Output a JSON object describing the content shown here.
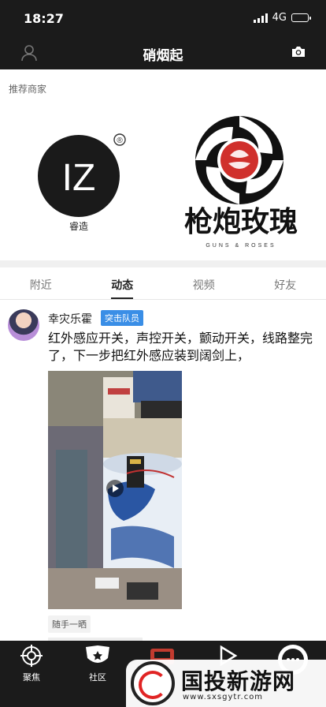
{
  "status_bar": {
    "time": "18:27",
    "network": "4G"
  },
  "navbar": {
    "title": "硝烟起"
  },
  "recommended": {
    "label": "推荐商家",
    "brands": [
      {
        "name_text": "睿造",
        "mark": "IZ",
        "registered": "®"
      },
      {
        "name_text": "枪炮玫瑰",
        "sub_text": "GUNS & ROSES"
      }
    ]
  },
  "tabs": [
    {
      "label": "附近",
      "active": false
    },
    {
      "label": "动态",
      "active": true
    },
    {
      "label": "视频",
      "active": false
    },
    {
      "label": "好友",
      "active": false
    }
  ],
  "post": {
    "username": "幸灾乐霍",
    "badge": "突击队员",
    "text": "红外感应开关，声控开关，颤动开关，线路整完了，下一步把红外感应装到阔剑上，",
    "tag": "随手一晒"
  },
  "bottom_nav": [
    {
      "label": "聚焦",
      "icon": "crosshair-icon"
    },
    {
      "label": "社区",
      "icon": "badge-icon"
    },
    {
      "label": "",
      "icon": "center-icon"
    },
    {
      "label": "",
      "icon": "play-icon"
    },
    {
      "label": "",
      "icon": "chat-icon"
    }
  ],
  "watermark": {
    "brand": "国投新游网",
    "url": "www.sxsgytr.com"
  },
  "colors": {
    "bar_bg": "#1b1b1b",
    "badge_blue": "#3a8ee6",
    "rose_red": "#d0302c"
  }
}
